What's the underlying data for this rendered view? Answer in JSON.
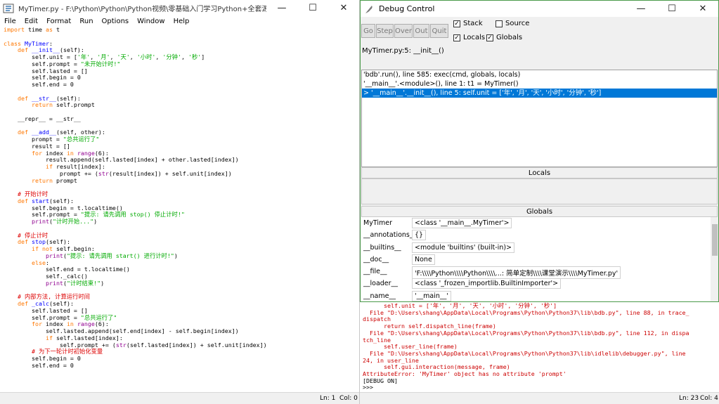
{
  "editor": {
    "title": "MyTimer.py - F:\\Python\\Python\\Python视频\\零基础入门学习Python+全套源码课件-资源共...",
    "menus": [
      "File",
      "Edit",
      "Format",
      "Run",
      "Options",
      "Window",
      "Help"
    ],
    "status_line": "Ln: 1",
    "status_col": "Col: 0"
  },
  "debug": {
    "title": "Debug Control",
    "buttons": [
      "Go",
      "Step",
      "Over",
      "Out",
      "Quit"
    ],
    "checks": {
      "stack": "Stack",
      "source": "Source",
      "locals": "Locals",
      "globals": "Globals"
    },
    "where": "MyTimer.py:5: __init__()",
    "stack": [
      "'bdb'.run(), line 585: exec(cmd, globals, locals)",
      "'__main__'.<module>(), line 1: t1 = MyTimer()",
      "> '__main__'.__init__(), line 5: self.unit = ['年', '月', '天', '小时', '分钟', '秒']"
    ],
    "locals_label": "Locals",
    "globals_label": "Globals",
    "globals": [
      {
        "key": "MyTimer",
        "value": "<class '__main__.MyTimer'>"
      },
      {
        "key": "__annotations__",
        "value": "{}"
      },
      {
        "key": "__builtins__",
        "value": "<module 'builtins' (built-in)>"
      },
      {
        "key": "__doc__",
        "value": "None"
      },
      {
        "key": "__file__",
        "value": "'F:\\\\\\\\Python\\\\\\\\Python\\\\\\\\...:  简单定制\\\\\\\\课堂演示\\\\\\\\MyTimer.py'"
      },
      {
        "key": "__loader__",
        "value": "<class '_frozen_importlib.BuiltinImporter'>"
      },
      {
        "key": "__name__",
        "value": "'__main__'"
      }
    ]
  },
  "shell": {
    "status_line": "Ln: 23",
    "status_col": "Col: 4"
  },
  "colors": {
    "keyword": "#ff7700",
    "definition": "#0000ff",
    "string": "#00aa00",
    "comment": "#dd0000",
    "builtin": "#900090",
    "selection": "#0078d7",
    "error": "#cc0000"
  }
}
